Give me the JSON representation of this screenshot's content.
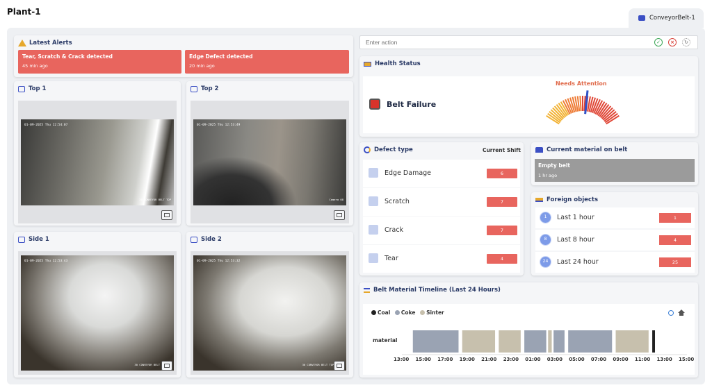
{
  "header": {
    "plant_title": "Plant-1",
    "belt_tab": "ConveyorBelt-1"
  },
  "alerts": {
    "title": "Latest Alerts",
    "items": [
      {
        "title": "Tear, Scratch & Crack detected",
        "time": "45 min ago"
      },
      {
        "title": "Edge Defect detected",
        "time": "20 min ago"
      }
    ]
  },
  "cameras": [
    {
      "title": "Top 1",
      "timestamp": "01-09-2025 Thu 12:54:07",
      "label": "30 CONVEYOR BELT TOP"
    },
    {
      "title": "Top 2",
      "timestamp": "01-09-2025 Thu 12:53:49",
      "label": "Camera 08"
    },
    {
      "title": "Side 1",
      "timestamp": "01-09-2025 Thu 12:53:43",
      "label": "30 CONVEYOR BELT BOTTOM"
    },
    {
      "title": "Side 2",
      "timestamp": "01-09-2025 Thu 12:53:32",
      "label": "30 CONVEYOR BELT TOP SIDE1"
    }
  ],
  "action": {
    "placeholder": "Enter action"
  },
  "health": {
    "title": "Health Status",
    "status": "Belt Failure",
    "gauge_label": "Needs Attention",
    "gauge_level": 0.55
  },
  "defects": {
    "title": "Defect type",
    "column": "Current Shift",
    "items": [
      {
        "name": "Edge Damage",
        "count": "6"
      },
      {
        "name": "Scratch",
        "count": "7"
      },
      {
        "name": "Crack",
        "count": "7"
      },
      {
        "name": "Tear",
        "count": "4"
      }
    ]
  },
  "material": {
    "title": "Current material on belt",
    "value": "Empty belt",
    "time": "1 hr ago"
  },
  "foreign": {
    "title": "Foreign objects",
    "items": [
      {
        "icon_text": "1",
        "name": "Last 1 hour",
        "count": "1"
      },
      {
        "icon_text": "8",
        "name": "Last 8 hour",
        "count": "4"
      },
      {
        "icon_text": "24",
        "name": "Last 24 hour",
        "count": "25"
      }
    ]
  },
  "timeline": {
    "title": "Belt Material Timeline (Last 24 Hours)",
    "legend": [
      {
        "name": "Coal",
        "color": "#222222"
      },
      {
        "name": "Coke",
        "color": "#9aa3b3"
      },
      {
        "name": "Sinter",
        "color": "#c7c0ad"
      }
    ],
    "row_label": "material",
    "ticks": [
      "13:00",
      "15:00",
      "17:00",
      "19:00",
      "21:00",
      "23:00",
      "01:00",
      "03:00",
      "05:00",
      "07:00",
      "09:00",
      "11:00",
      "13:00",
      "15:00"
    ]
  },
  "chart_data": {
    "type": "bar",
    "title": "Belt Material Timeline (Last 24 Hours)",
    "categories": [
      "material"
    ],
    "segments": [
      {
        "material": "Coke",
        "start": "14:00",
        "end": "18:10"
      },
      {
        "material": "Sinter",
        "start": "18:30",
        "end": "21:30"
      },
      {
        "material": "Sinter",
        "start": "21:50",
        "end": "23:50"
      },
      {
        "material": "Coke",
        "start": "00:10",
        "end": "02:10"
      },
      {
        "material": "Sinter",
        "start": "02:20",
        "end": "02:40"
      },
      {
        "material": "Coke",
        "start": "02:50",
        "end": "03:50"
      },
      {
        "material": "Coke",
        "start": "04:10",
        "end": "08:10"
      },
      {
        "material": "Sinter",
        "start": "08:30",
        "end": "11:30"
      },
      {
        "material": "Coal",
        "start": "11:50",
        "end": "12:05"
      }
    ],
    "x_ticks": [
      "13:00",
      "15:00",
      "17:00",
      "19:00",
      "21:00",
      "23:00",
      "01:00",
      "03:00",
      "05:00",
      "07:00",
      "09:00",
      "11:00",
      "13:00",
      "15:00"
    ]
  },
  "colors": {
    "alert": "#e8655e",
    "accent": "#3b4fc4",
    "coal": "#222222",
    "coke": "#9aa3b3",
    "sinter": "#c7c0ad"
  }
}
